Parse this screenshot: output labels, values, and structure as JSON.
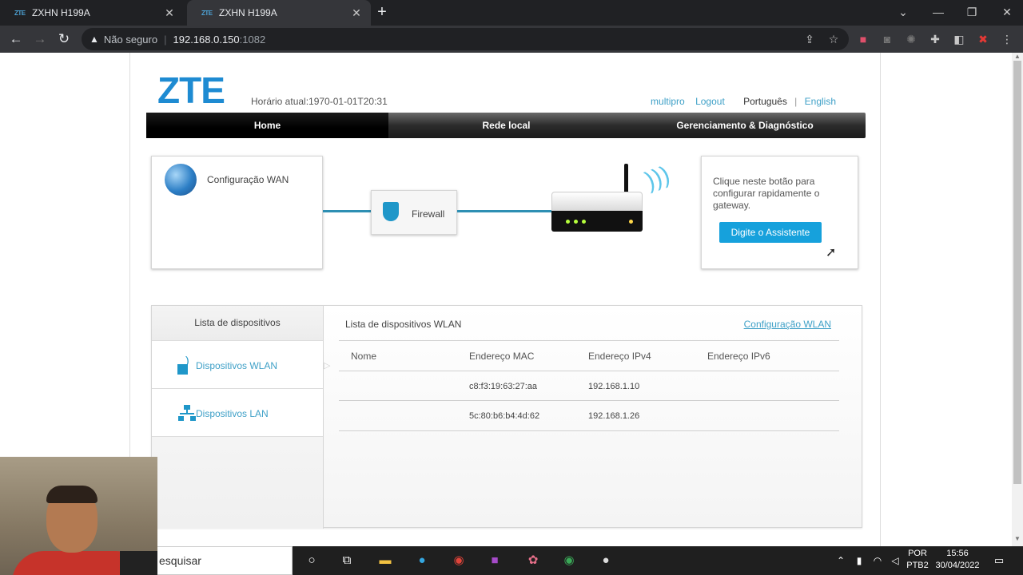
{
  "browser": {
    "tabs": [
      {
        "favicon": "ZTE",
        "title": "ZXHN H199A"
      },
      {
        "favicon": "ZTE",
        "title": "ZXHN H199A"
      }
    ],
    "address": {
      "security_label": "Não seguro",
      "host": "192.168.0.150",
      "port": ":1082"
    }
  },
  "header": {
    "logo": "ZTE",
    "clock": "Horário atual:1970-01-01T20:31",
    "links": {
      "user": "multipro",
      "logout": "Logout",
      "lang_pt": "Português",
      "separator": "|",
      "lang_en": "English"
    }
  },
  "menu": {
    "home": "Home",
    "lan": "Rede local",
    "mgmt": "Gerenciamento & Diagnóstico"
  },
  "topology": {
    "wan_label": "Configuração WAN",
    "firewall_label": "Firewall"
  },
  "assistant": {
    "text": "Clique neste botão para configurar rapidamente o gateway.",
    "button": "Digite o Assistente"
  },
  "devices": {
    "side_title": "Lista de dispositivos",
    "side_items": [
      "Dispositivos WLAN",
      "Dispositivos LAN"
    ],
    "title": "Lista de dispositivos WLAN",
    "config_link": "Configuração WLAN",
    "columns": [
      "Nome",
      "Endereço MAC",
      "Endereço IPv4",
      "Endereço IPv6"
    ],
    "rows": [
      {
        "name": "",
        "mac": "c8:f3:19:63:27:aa",
        "ipv4": "192.168.1.10",
        "ipv6": ""
      },
      {
        "name": "",
        "mac": "5c:80:b6:b4:4d:62",
        "ipv4": "192.168.1.26",
        "ipv6": ""
      }
    ]
  },
  "taskbar": {
    "search_text": "esquisar",
    "lang": "POR",
    "layout": "PTB2",
    "time": "15:56",
    "date": "30/04/2022"
  }
}
